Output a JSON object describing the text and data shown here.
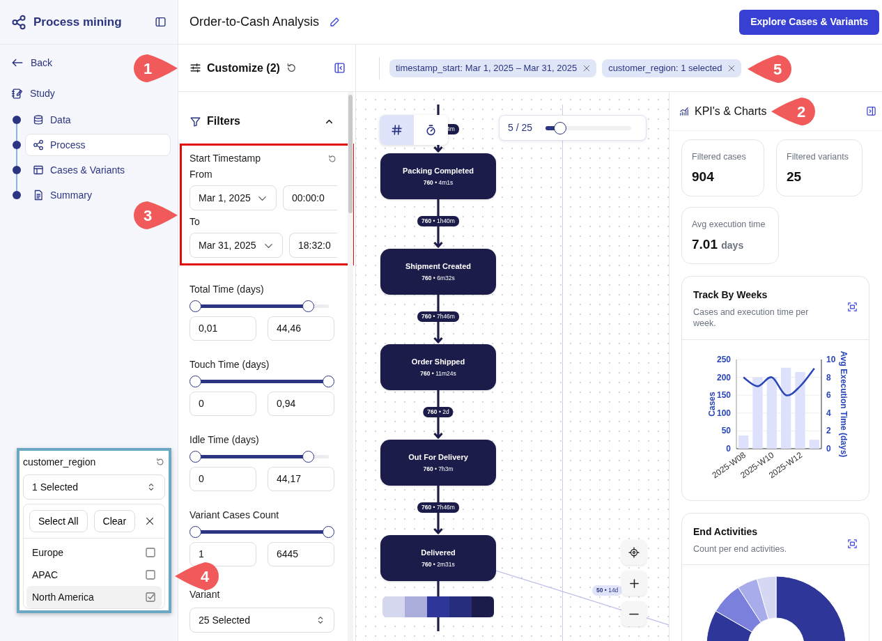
{
  "sidebar": {
    "title": "Process mining",
    "back": "Back",
    "section": "Study",
    "steps": [
      {
        "label": "Data",
        "selected": false
      },
      {
        "label": "Process",
        "selected": true
      },
      {
        "label": "Cases & Variants",
        "selected": false
      },
      {
        "label": "Summary",
        "selected": false
      }
    ]
  },
  "header": {
    "title": "Order-to-Cash Analysis",
    "action": "Explore Cases & Variants"
  },
  "customize": {
    "title": "Customize (2)",
    "filters_title": "Filters",
    "expanded": true,
    "timestamp": {
      "label": "Start Timestamp",
      "highlighted": true,
      "rows": [
        {
          "label": "From",
          "date": "Mar 1, 2025",
          "time": "00:00:0"
        },
        {
          "label": "To",
          "date": "Mar 31, 2025",
          "time": "18:32:0"
        }
      ]
    },
    "ranges": [
      {
        "label": "Total Time (days)",
        "level": 0.85,
        "min": "0,01",
        "max": "44,46"
      },
      {
        "label": "Touch Time (days)",
        "level": 1,
        "min": "0",
        "max": "0,94"
      },
      {
        "label": "Idle Time (days)",
        "level": 0.85,
        "min": "0",
        "max": "44,17"
      },
      {
        "label": "Variant Cases Count",
        "level": 1,
        "min": "1",
        "max": "6445"
      }
    ],
    "variant": {
      "label": "Variant",
      "value": "25 Selected"
    }
  },
  "region_popup": {
    "title": "customer_region",
    "value": "1 Selected",
    "highlighted": true,
    "buttons": [
      "Select All",
      "Clear"
    ],
    "options": [
      {
        "label": "Europe",
        "selected": false
      },
      {
        "label": "APAC",
        "selected": false
      },
      {
        "label": "North America",
        "selected": true
      }
    ]
  },
  "chips": [
    {
      "text": "timestamp_start: Mar 1, 2025 – Mar 31, 2025"
    },
    {
      "text": "customer_region: 1 selected"
    }
  ],
  "canvas": {
    "modes": [
      {
        "kind": "count",
        "selected": true
      },
      {
        "kind": "time",
        "selected": false
      }
    ],
    "variants": {
      "text": "5 / 25",
      "level": 0.17
    },
    "top_edge_label": "4m",
    "nodes": [
      {
        "name": "Packing Completed",
        "stats": "**760** • 4m1s"
      },
      {
        "name": "Shipment Created",
        "stats": "**760** • 6m32s"
      },
      {
        "name": "Order Shipped",
        "stats": "**760** • 11m24s"
      },
      {
        "name": "Out For Delivery",
        "stats": "**760** • 7h3m"
      },
      {
        "name": "Delivered",
        "stats": "**760** • 2m31s"
      }
    ],
    "edges": [
      "**760** • 1h40m",
      "**760** • 7h46m",
      "**760** • 2d",
      "**760** • 7h46m"
    ],
    "side_edge": "**50** • 14d"
  },
  "kpi": {
    "title": "KPI's & Charts",
    "cards": [
      {
        "label": "Filtered cases",
        "value": "904"
      },
      {
        "label": "Filtered variants",
        "value": "25"
      },
      {
        "label": "Avg execution time",
        "value": "7.01",
        "unit": "days"
      }
    ],
    "track": {
      "title": "Track By Weeks",
      "subtitle": "Cases and execution time per week.",
      "chart_data": {
        "type": "bar",
        "grid": true,
        "ylabel": "Cases",
        "y2label": "Avg Execution Time (days)",
        "yticks": [
          0,
          50,
          100,
          150,
          200,
          250
        ],
        "ylim": [
          0,
          250
        ],
        "y2ticks": [
          0,
          2,
          4,
          6,
          8,
          10
        ],
        "y2lim": [
          0,
          10
        ],
        "categories": [
          "2025-W08",
          null,
          "2025-W10",
          null,
          "2025-W12",
          null
        ],
        "series": [
          {
            "color": "#dde1fb",
            "values": [
              37,
              200,
              200,
              227,
              215,
              25
            ]
          },
          {
            "type": "line",
            "axis": "y2",
            "color": "#2a46b8",
            "values": [
              8,
              7,
              8,
              6,
              7,
              9
            ]
          }
        ]
      }
    },
    "end": {
      "title": "End Activities",
      "subtitle": "Count per end activities."
    }
  },
  "annotations": [
    {
      "number": "1"
    },
    {
      "number": "2"
    },
    {
      "number": "3"
    },
    {
      "number": "4"
    },
    {
      "number": "5"
    }
  ]
}
